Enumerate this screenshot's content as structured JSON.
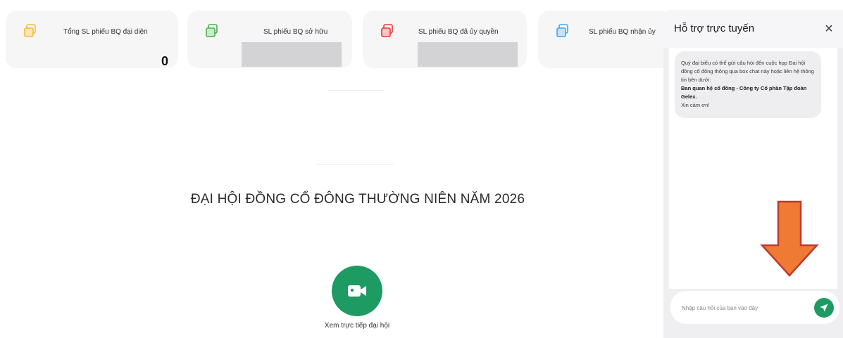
{
  "stats": [
    {
      "label": "Tổng SL phiếu BQ đại diện",
      "value": "0",
      "icon": "ballot-icon",
      "icon_color": "#f5b942"
    },
    {
      "label": "SL phiếu BQ sở hữu",
      "value": "",
      "icon": "ballot-icon",
      "icon_color": "#4caf50"
    },
    {
      "label": "SL phiếu BQ đã ủy quyền",
      "value": "",
      "icon": "ballot-icon",
      "icon_color": "#e53935"
    },
    {
      "label": "SL phiếu BQ nhận ủy",
      "value": "",
      "icon": "ballot-icon",
      "icon_color": "#42a5f5"
    }
  ],
  "main": {
    "title": "ĐẠI HỘI ĐỒNG CỔ ĐÔNG THƯỜNG NIÊN NĂM 2026",
    "watch_label": "Xem trực tiếp đại hội",
    "watch_icon": "video-camera-icon"
  },
  "chat": {
    "title": "Hỗ trợ trực tuyến",
    "close_label": "×",
    "message_intro": "Quý đại biểu có thể gửi câu hỏi đến cuộc họp Đại hội đồng cổ đông thông qua box chat này hoặc liên hệ thông tin bên dưới:",
    "message_org": "Ban quan hệ cổ đông - Công ty Cổ phần Tập đoàn Gelex.",
    "message_thanks": "Xin cảm ơn!",
    "input_placeholder": "Nhập câu hỏi của bạn vào đây",
    "send_icon": "send-icon"
  },
  "colors": {
    "accent_green": "#1e9a63",
    "annotation_arrow": "#ee7a33"
  }
}
